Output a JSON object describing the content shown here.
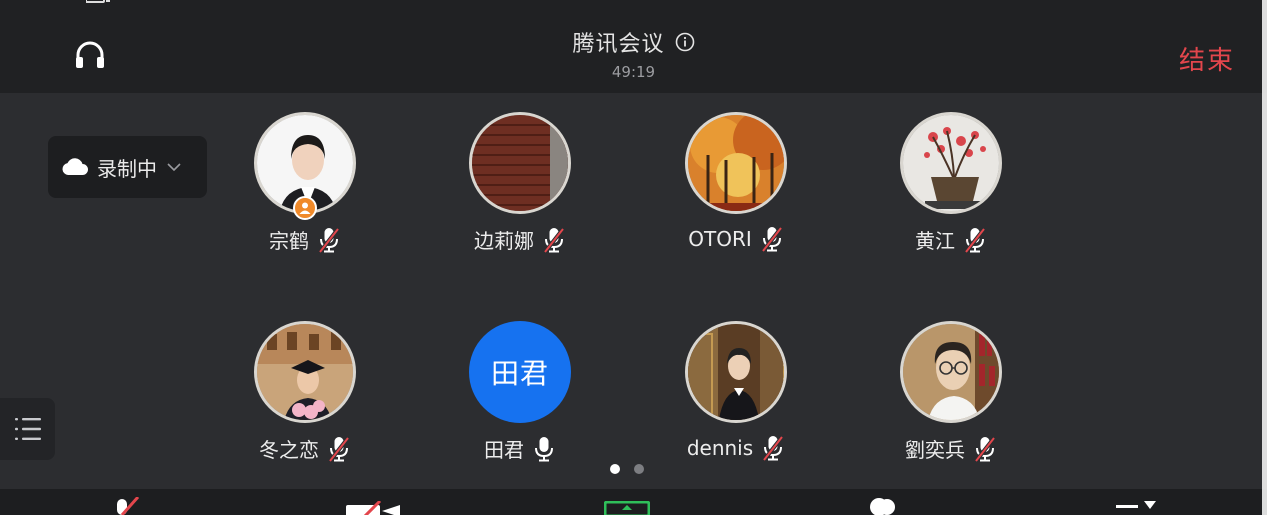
{
  "header": {
    "title": "腾讯会议",
    "timer": "49:19",
    "end_label": "结束"
  },
  "recording": {
    "label": "录制中"
  },
  "participants": [
    {
      "name": "宗鹤",
      "mic": "muted",
      "host": true
    },
    {
      "name": "边莉娜",
      "mic": "muted",
      "host": false
    },
    {
      "name": "OTORI",
      "mic": "muted",
      "host": false
    },
    {
      "name": "黄江",
      "mic": "muted",
      "host": false
    },
    {
      "name": "冬之恋",
      "mic": "muted",
      "host": false
    },
    {
      "name": "田君",
      "mic": "on",
      "host": false,
      "avatar_text": "田君",
      "avatar_color": "#1672f0"
    },
    {
      "name": "dennis",
      "mic": "muted",
      "host": false
    },
    {
      "name": "劉奕兵",
      "mic": "muted",
      "host": false
    }
  ],
  "pagination": {
    "pages": 2,
    "current": 1
  },
  "colors": {
    "end": "#e3464c",
    "accent": "#1672f0",
    "muted_slash": "#e3464c",
    "host_badge": "#f08a2a"
  },
  "icons": {
    "header_left": "headset-icon",
    "title_info": "info-icon",
    "recording": "cloud-icon",
    "left_list": "list-icon"
  }
}
